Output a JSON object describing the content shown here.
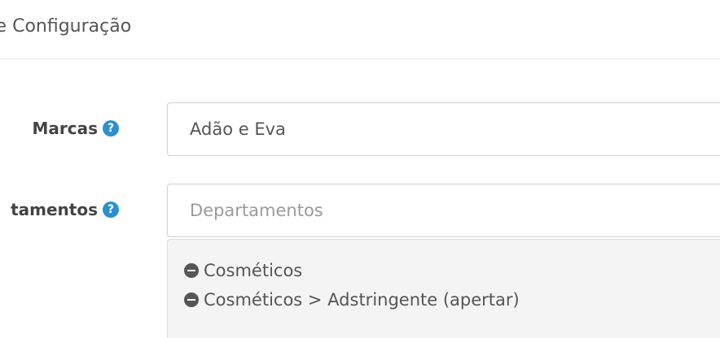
{
  "section": {
    "title": "re Configuração"
  },
  "form": {
    "brands": {
      "label": "Marcas",
      "value": "Adão e Eva",
      "help": "?"
    },
    "departments": {
      "label": "tamentos",
      "placeholder": "Departamentos",
      "help": "?",
      "selected": [
        {
          "label": "Cosméticos"
        },
        {
          "label": "Cosméticos > Adstringente (apertar)"
        }
      ]
    }
  },
  "colors": {
    "help_icon": "#2d8fd0",
    "well_background": "#f4f4f4"
  },
  "icons": {
    "help": "question-circle-icon",
    "remove": "minus-circle-icon"
  }
}
